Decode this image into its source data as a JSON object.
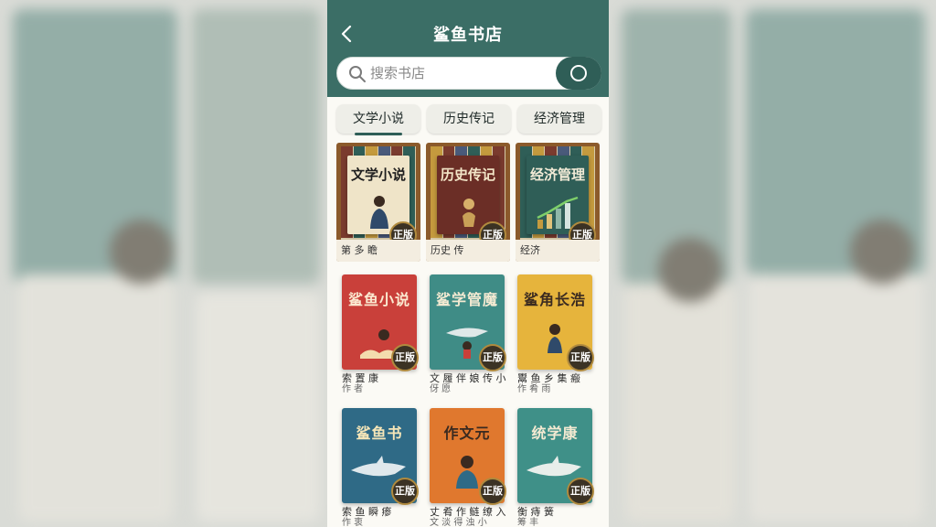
{
  "app": {
    "title": "鲨鱼书店"
  },
  "search": {
    "placeholder": "搜索书店",
    "value": ""
  },
  "tabs": [
    {
      "label": "文学小说"
    },
    {
      "label": "历史传记"
    },
    {
      "label": "经济管理"
    }
  ],
  "featured": [
    {
      "cover_title": "文学小说",
      "caption": "第 多 瞻",
      "badge": "正版"
    },
    {
      "cover_title": "历史传记",
      "caption": "历史 传",
      "badge": "正版"
    },
    {
      "cover_title": "经济管理",
      "caption": "经济",
      "badge": "正版"
    }
  ],
  "books": [
    {
      "cover_title": "鲨鱼小说",
      "name": "索 置 康",
      "author": "作 者",
      "badge": "正版"
    },
    {
      "cover_title": "鲨学管魔",
      "name": "文 履 伴 娘 传 小",
      "author": "伢 愿",
      "badge": "正版"
    },
    {
      "cover_title": "鲨角长浩",
      "name": "鬻 鱼 乡 集 瘢",
      "author": "作 肴 雨",
      "badge": "正版"
    },
    {
      "cover_title": "鲨鱼书",
      "name": "索 鱼 瞬 瘆",
      "author": "作 衷",
      "badge": "正版"
    },
    {
      "cover_title": "作文元",
      "name": "丈 肴 作 鲢 缭 入",
      "author": "文 淡 得 浊 小",
      "badge": "正版"
    },
    {
      "cover_title": "统学康",
      "name": "衡 痔 簧",
      "author": "筹 丰",
      "badge": "正版"
    }
  ],
  "colors": {
    "header": "#3b6e66",
    "accent": "#2f5e57",
    "badge": "#3b3224"
  },
  "icons": {
    "back": "chevron-left-icon",
    "search": "search-icon",
    "scan": "scan-icon",
    "badge": "authentic-badge"
  }
}
